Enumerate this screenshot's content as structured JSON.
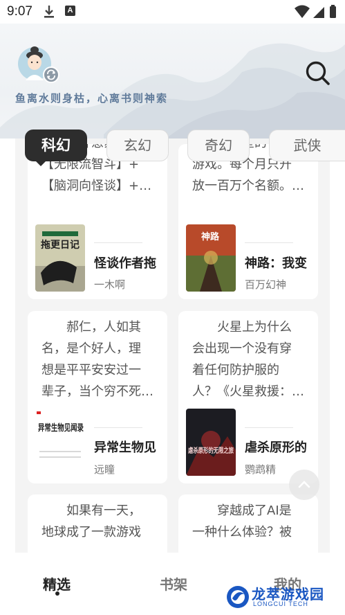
{
  "status_bar": {
    "time": "9:07",
    "a_badge": "A",
    "icons": [
      "download-icon",
      "a-badge-icon",
      "wifi-icon",
      "signal-icon",
      "battery-icon"
    ]
  },
  "header": {
    "slogan": "鱼离水则身枯，心离书则神索",
    "icons": [
      "avatar-icon",
      "sync-icon",
      "search-icon"
    ]
  },
  "tabs": [
    {
      "label": "科幻",
      "active": true
    },
    {
      "label": "玄幻",
      "active": false
    },
    {
      "label": "奇幻",
      "active": false
    },
    {
      "label": "武侠",
      "active": false
    }
  ],
  "cards": [
    {
      "lines": [
        "女主，开患苏看】",
        "【无限流智斗】+",
        "【脑洞向怪谈】+…"
      ],
      "cover_label": "拖更日记",
      "title": "怪谈作者拖",
      "author": "一木啊"
    },
    {
      "lines": [
        "降临了蓝星的神秘",
        "游戏。每个月只开",
        "放一百万个名额。…"
      ],
      "cover_label": "神路",
      "title": "神路：我变",
      "author": "百万幻神"
    },
    {
      "lines": [
        "郝仁，人如其",
        "名，是个好人，理",
        "想是平平安安过一",
        "辈子，当个穷不死…"
      ],
      "cover_label": "异常生物见闻录",
      "title": "异常生物见",
      "author": "远瞳"
    },
    {
      "lines": [
        "火星上为什么",
        "会出现一个没有穿",
        "着任何防护服的",
        "人？《火星救援：…"
      ],
      "cover_label": "虐杀原形的无限之旅",
      "title": "虐杀原形的",
      "author": "鹦鹉精"
    },
    {
      "lines": [
        "如果有一天，",
        "地球成了一款游戏"
      ],
      "title": "",
      "author": ""
    },
    {
      "lines": [
        "穿越成了AI是",
        "一种什么体验？被"
      ],
      "title": "",
      "author": ""
    }
  ],
  "bottom_nav": [
    {
      "label": "精选",
      "active": true
    },
    {
      "label": "书架",
      "active": false
    },
    {
      "label": "我的",
      "active": false
    }
  ],
  "watermark": {
    "text": "龙萃游戏园",
    "sub": "LONGCUI TECH"
  },
  "colors": {
    "accent_dark": "#2d2d2d",
    "slogan": "#5f7a9a",
    "watermark": "#1a57c2"
  }
}
